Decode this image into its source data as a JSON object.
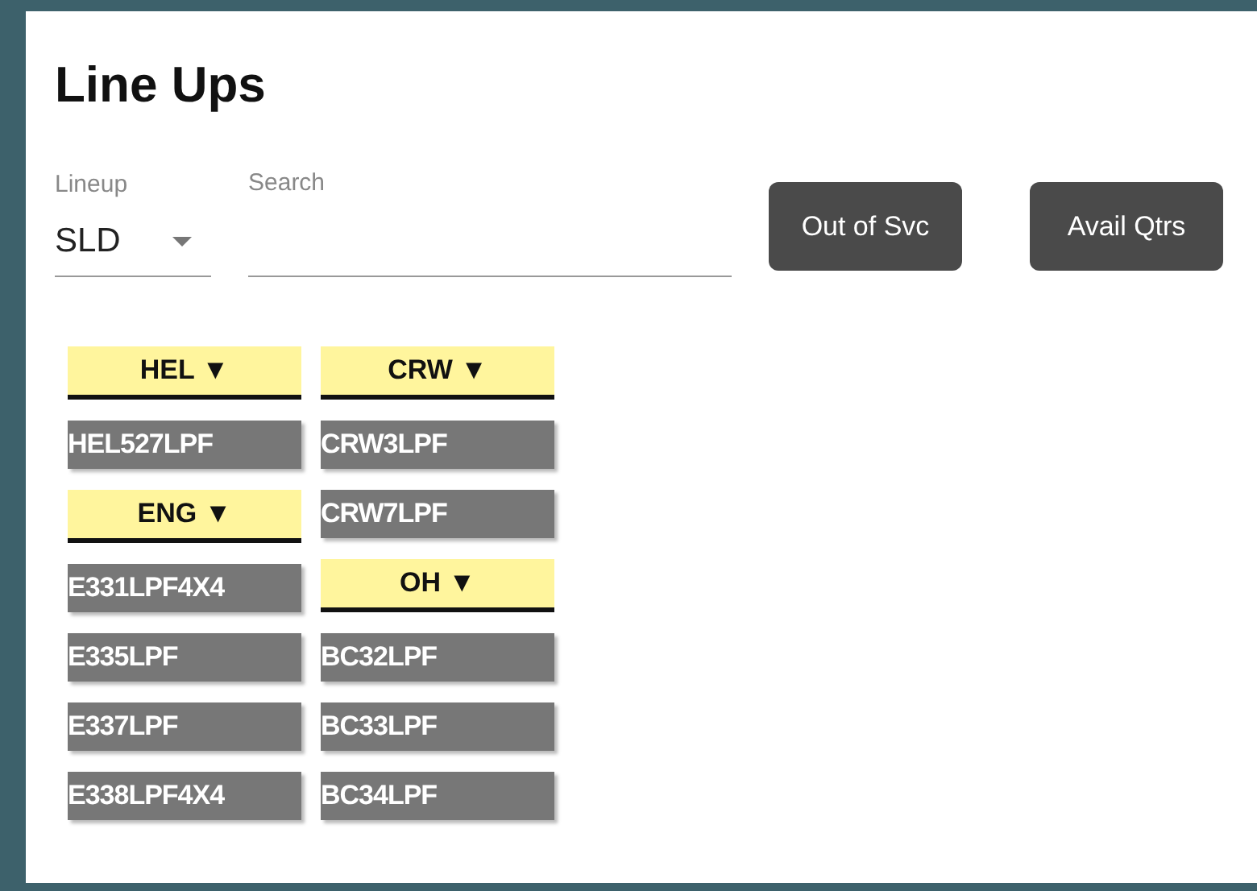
{
  "title": "Line Ups",
  "lineup": {
    "label": "Lineup",
    "value": "SLD"
  },
  "search": {
    "label": "Search"
  },
  "buttons": [
    "Out of Svc",
    "Avail Qtrs"
  ],
  "columns": [
    {
      "items": [
        {
          "kind": "group",
          "label": "HEL ▼"
        },
        {
          "kind": "unit",
          "label": "HEL527LPF"
        },
        {
          "kind": "group",
          "label": "ENG ▼"
        },
        {
          "kind": "unit",
          "label": "E331LPF4X4"
        },
        {
          "kind": "unit",
          "label": "E335LPF"
        },
        {
          "kind": "unit",
          "label": "E337LPF"
        },
        {
          "kind": "unit",
          "label": "E338LPF4X4"
        }
      ]
    },
    {
      "items": [
        {
          "kind": "group",
          "label": "CRW ▼"
        },
        {
          "kind": "unit",
          "label": "CRW3LPF"
        },
        {
          "kind": "unit",
          "label": "CRW7LPF"
        },
        {
          "kind": "group",
          "label": "OH ▼"
        },
        {
          "kind": "unit",
          "label": "BC32LPF"
        },
        {
          "kind": "unit",
          "label": "BC33LPF"
        },
        {
          "kind": "unit",
          "label": "BC34LPF"
        }
      ]
    }
  ]
}
